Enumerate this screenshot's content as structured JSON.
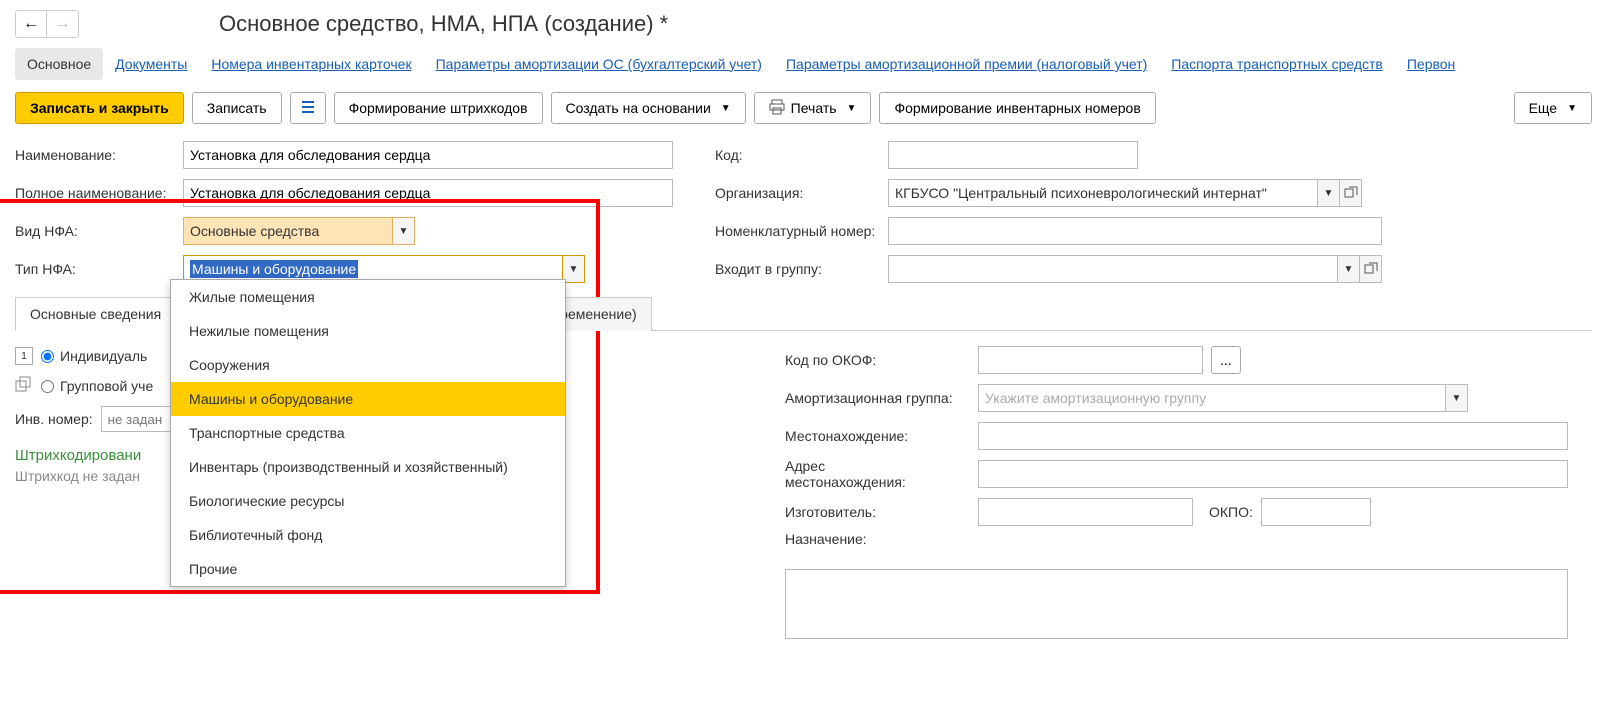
{
  "page_title": "Основное средство, НМА, НПА (создание) *",
  "nav_tabs": {
    "main": "Основное",
    "docs": "Документы",
    "inv_cards": "Номера инвентарных карточек",
    "amort_params": "Параметры амортизации ОС (бухгалтерский учет)",
    "amort_bonus": "Параметры амортизационной премии (налоговый учет)",
    "passports": "Паспорта транспортных средств",
    "first": "Первон"
  },
  "toolbar": {
    "save_close": "Записать и закрыть",
    "save": "Записать",
    "barcode_gen": "Формирование штрихкодов",
    "create_based": "Создать на основании",
    "print": "Печать",
    "inv_numbers": "Формирование инвентарных номеров",
    "more": "Еще"
  },
  "form": {
    "name_label": "Наименование:",
    "name_value": "Установка для обследования сердца",
    "full_name_label": "Полное наименование:",
    "full_name_value": "Установка для обследования сердца",
    "nfa_kind_label": "Вид НФА:",
    "nfa_kind_value": "Основные средства",
    "nfa_type_label": "Тип НФА:",
    "nfa_type_value": "Машины и оборудование",
    "code_label": "Код:",
    "org_label": "Организация:",
    "org_value": "КГБУСО \"Центральный психоневрологический интернат\"",
    "nomen_label": "Номенклатурный номер:",
    "group_label": "Входит в группу:"
  },
  "dropdown_options": [
    "Жилые помещения",
    "Нежилые помещения",
    "Сооружения",
    "Машины и оборудование",
    "Транспортные средства",
    "Инвентарь (производственный и хозяйственный)",
    "Биологические ресурсы",
    "Библиотечный фонд",
    "Прочие"
  ],
  "dropdown_selected_index": 3,
  "tabs": {
    "main_info": "Основные сведения",
    "usage_term": "ременение)"
  },
  "left": {
    "individual": "Индивидуаль",
    "group": "Групповой уче",
    "inv_label": "Инв. номер:",
    "inv_value": "не задан",
    "barcode_title": "Штрихкодировани",
    "barcode_hint": "Штрихкод не задан"
  },
  "right": {
    "okof_label": "Код по ОКОФ:",
    "okof_btn": "...",
    "amort_group_label": "Амортизационная группа:",
    "amort_group_placeholder": "Укажите амортизационную группу",
    "location_label": "Местонахождение:",
    "address_label1": "Адрес",
    "address_label2": "местонахождения:",
    "manufacturer_label": "Изготовитель:",
    "okpo_label": "ОКПО:",
    "purpose_label": "Назначение:"
  }
}
